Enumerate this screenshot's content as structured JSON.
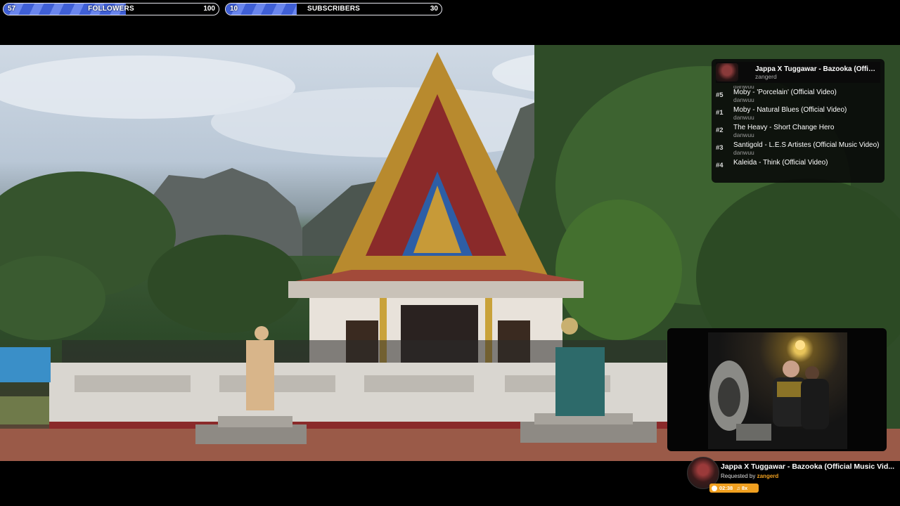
{
  "goals": {
    "followers": {
      "current": "57",
      "label": "FOLLOWERS",
      "target": "100",
      "progress": 0.57
    },
    "subscribers": {
      "current": "10",
      "label": "SUBSCRIBERS",
      "target": "30",
      "progress": 0.33
    }
  },
  "queue": {
    "now_playing": {
      "title": "Jappa X Tuggawar - Bazooka (Offici...",
      "requester": "zangerd"
    },
    "items": [
      {
        "position": "#5",
        "title": "Moby - 'Porcelain' (Official Video)",
        "requester": "danwuu"
      },
      {
        "position": "#1",
        "title": "Moby - Natural Blues (Official Video)",
        "requester": "danwuu"
      },
      {
        "position": "#2",
        "title": "The Heavy - Short Change Hero",
        "requester": "danwuu"
      },
      {
        "position": "#3",
        "title": "Santigold - L.E.S Artistes (Official Music Video)",
        "requester": "danwuu"
      },
      {
        "position": "#4",
        "title": "Kaleida - Think (Official Video)",
        "requester": ""
      }
    ],
    "partial_top_requester": "danwuu"
  },
  "now_playing": {
    "title": "Jappa X Tuggawar - Bazooka (Official Music Vid...",
    "requested_by_label": "Requested by",
    "requester": "zangerd",
    "time": "02:38",
    "count": "8x"
  },
  "colors": {
    "accent": "#f0a020",
    "goal_fill": "#4a68e0"
  }
}
